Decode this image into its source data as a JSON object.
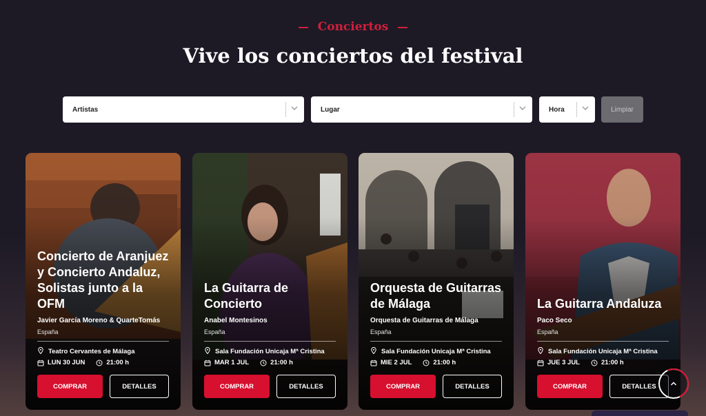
{
  "header": {
    "eyebrow": "Conciertos",
    "title": "Vive los conciertos del festival"
  },
  "filters": {
    "artistas": "Artistas",
    "lugar": "Lugar",
    "hora": "Hora",
    "limpiar": "Limpiar"
  },
  "cards": [
    {
      "title": "Concierto de Aranjuez y Concierto Andaluz, Solistas junto a la OFM",
      "artist": "Javier García Moreno & QuarteTomás",
      "country": "España",
      "venue": "Teatro Cervantes de Málaga",
      "date": "LUN 30 JUN",
      "time": "21:00 h",
      "buy": "COMPRAR",
      "details": "DETALLES"
    },
    {
      "title": "La Guitarra de Concierto",
      "artist": "Anabel Montesinos",
      "country": "España",
      "venue": "Sala Fundación Unicaja Mª Cristina",
      "date": "MAR 1 JUL",
      "time": "21:00 h",
      "buy": "COMPRAR",
      "details": "DETALLES"
    },
    {
      "title": "Orquesta de Guitarras de Málaga",
      "artist": "Orquesta de Guitarras de Málaga",
      "country": "España",
      "venue": "Sala Fundación Unicaja Mª Cristina",
      "date": "MIE 2 JUL",
      "time": "21:00 h",
      "buy": "COMPRAR",
      "details": "DETALLES"
    },
    {
      "title": "La Guitarra Andaluza",
      "artist": "Paco Seco",
      "country": "España",
      "venue": "Sala Fundación Unicaja Mª Cristina",
      "date": "JUE 3 JUL",
      "time": "21:00 h",
      "buy": "COMPRAR",
      "details": "DETALLES"
    }
  ],
  "icons": {
    "dropdown": "chevron-down-icon",
    "venue": "location-pin-icon",
    "date": "calendar-icon",
    "time": "clock-icon",
    "scroll_top": "chevron-up-icon"
  },
  "colors": {
    "background": "#1d1a26",
    "accent": "#d7102f",
    "clear_button": "#6b6b70"
  }
}
